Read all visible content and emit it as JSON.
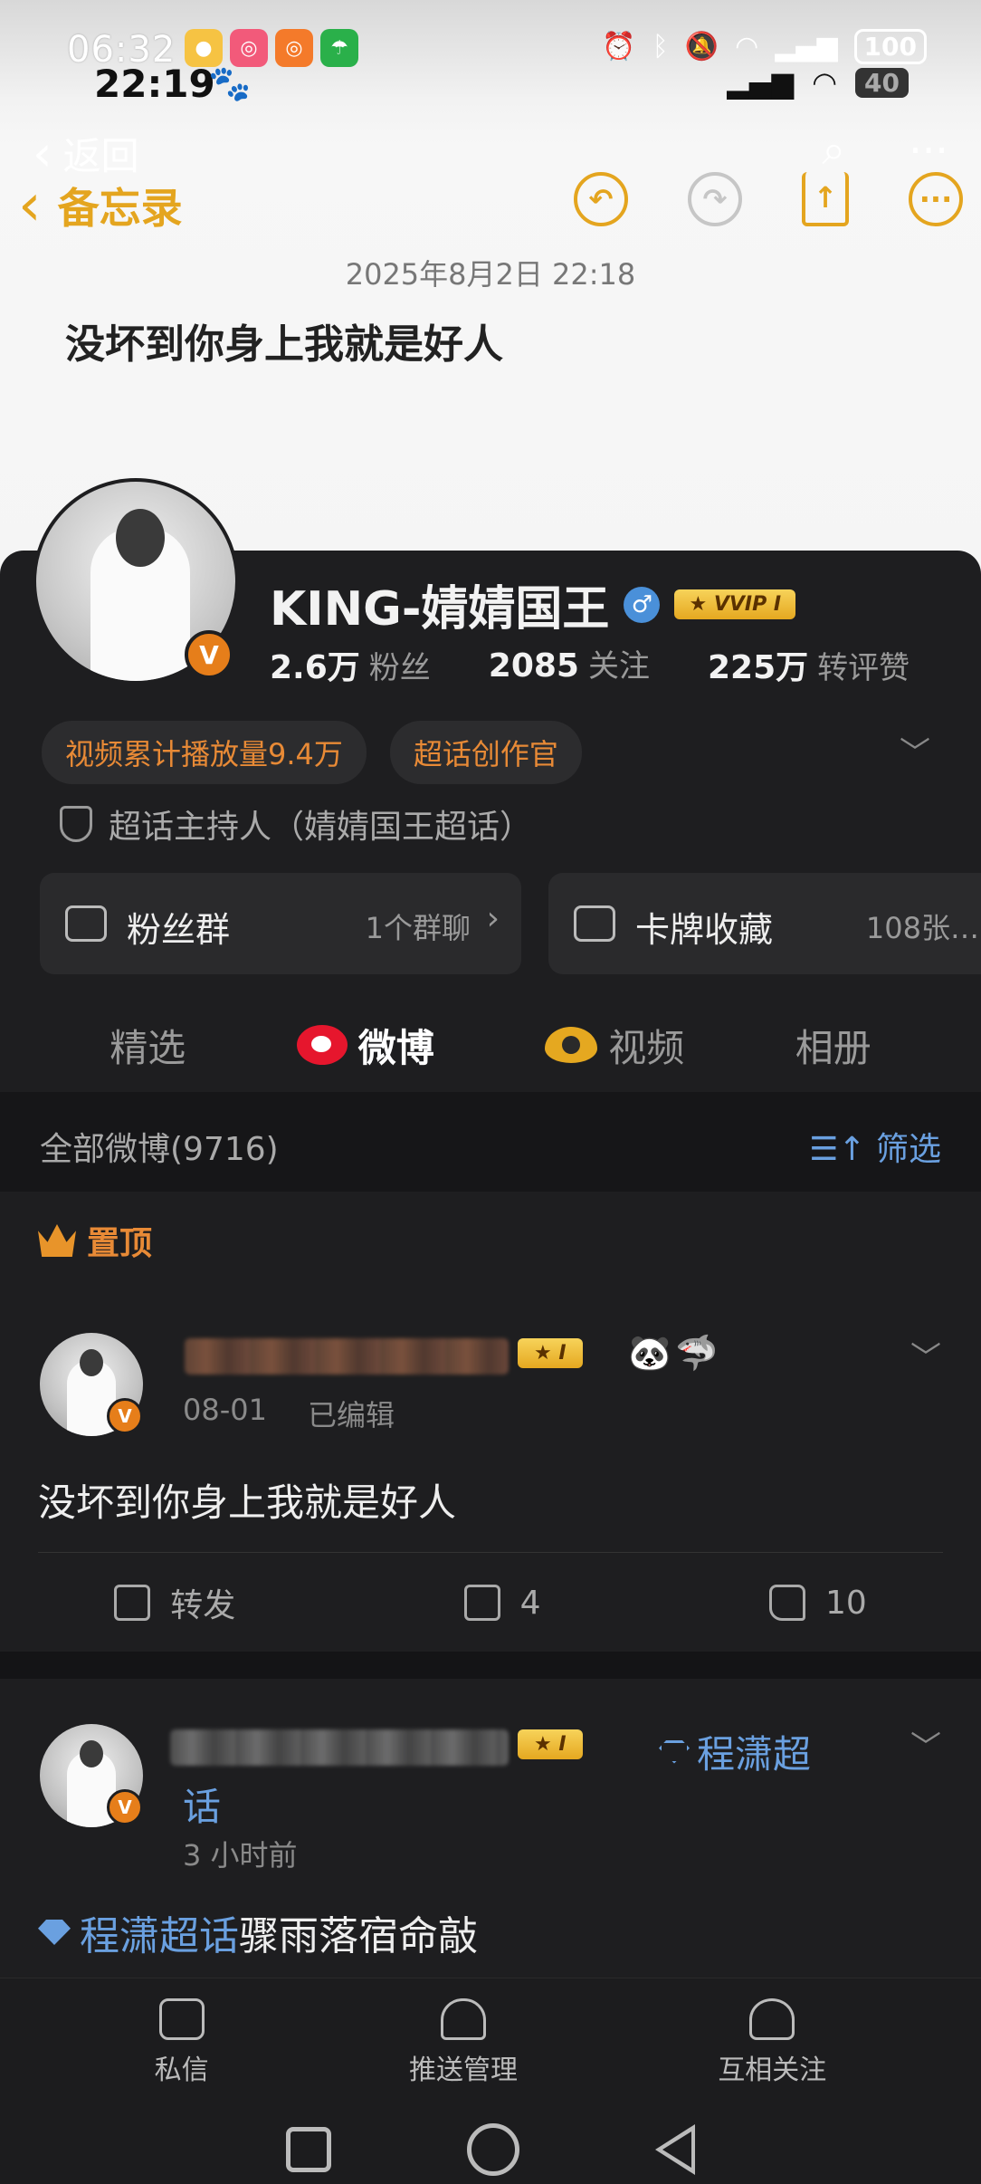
{
  "status_bar_top": {
    "time": "06:32",
    "battery": "100"
  },
  "status_bar_second": {
    "time": "22:19",
    "battery": "40"
  },
  "overlay_nav": {
    "back_label": "返回",
    "search_icon": "search-icon",
    "more_icon": "more-icon"
  },
  "memo": {
    "back_label": "备忘录",
    "date": "2025年8月2日 22:18",
    "text": "没坏到你身上我就是好人"
  },
  "profile": {
    "name": "KING-婧婧国王",
    "vvip_label": "VVIP",
    "vvip_level": "I",
    "stats": [
      {
        "value": "2.6万",
        "label": "粉丝"
      },
      {
        "value": "2085",
        "label": "关注"
      },
      {
        "value": "225万",
        "label": "转评赞"
      }
    ],
    "tags": [
      "视频累计播放量9.4万",
      "超话创作官"
    ],
    "host_text": "超话主持人（婧婧国王超话）",
    "cards": [
      {
        "title": "粉丝群",
        "value": "1个群聊"
      },
      {
        "title": "卡牌收藏",
        "value": "108张…"
      }
    ],
    "tabs": [
      "精选",
      "微博",
      "视频",
      "相册"
    ],
    "active_tab": "微博"
  },
  "feed": {
    "filter_title": "全部微博(9716)",
    "filter_button": "筛选",
    "pinned_label": "置顶",
    "post1": {
      "level": "I",
      "date": "08-01",
      "edited": "已编辑",
      "text": "没坏到你身上我就是好人",
      "repost_label": "转发",
      "comments": "4",
      "likes": "10"
    },
    "post2": {
      "level": "I",
      "topic_tag_a": "程潇超",
      "topic_tag_b": "话",
      "time": "3 小时前",
      "topic_inline": "程潇超话",
      "text_rest": "骤雨落宿命敲"
    }
  },
  "bottom_nav": [
    {
      "label": "私信",
      "icon": "message-icon"
    },
    {
      "label": "推送管理",
      "icon": "bell-icon"
    },
    {
      "label": "互相关注",
      "icon": "mutual-follow-icon"
    }
  ],
  "colors": {
    "accent": "#f07a2a",
    "memo_yellow": "#e4a51f",
    "link_blue": "#6aa0e0",
    "background": "#1e1e20"
  }
}
